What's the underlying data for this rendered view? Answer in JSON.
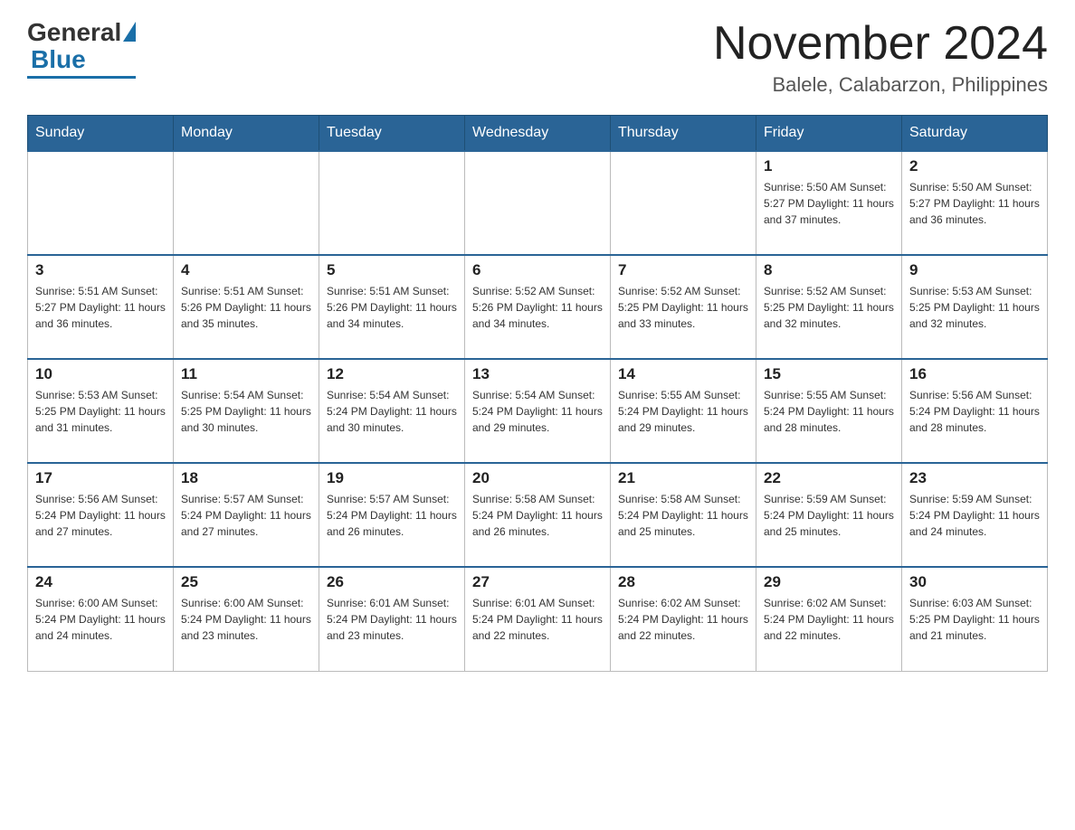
{
  "header": {
    "logo_general": "General",
    "logo_blue": "Blue",
    "month_title": "November 2024",
    "location": "Balele, Calabarzon, Philippines"
  },
  "weekdays": [
    "Sunday",
    "Monday",
    "Tuesday",
    "Wednesday",
    "Thursday",
    "Friday",
    "Saturday"
  ],
  "weeks": [
    [
      {
        "day": "",
        "info": ""
      },
      {
        "day": "",
        "info": ""
      },
      {
        "day": "",
        "info": ""
      },
      {
        "day": "",
        "info": ""
      },
      {
        "day": "",
        "info": ""
      },
      {
        "day": "1",
        "info": "Sunrise: 5:50 AM\nSunset: 5:27 PM\nDaylight: 11 hours and 37 minutes."
      },
      {
        "day": "2",
        "info": "Sunrise: 5:50 AM\nSunset: 5:27 PM\nDaylight: 11 hours and 36 minutes."
      }
    ],
    [
      {
        "day": "3",
        "info": "Sunrise: 5:51 AM\nSunset: 5:27 PM\nDaylight: 11 hours and 36 minutes."
      },
      {
        "day": "4",
        "info": "Sunrise: 5:51 AM\nSunset: 5:26 PM\nDaylight: 11 hours and 35 minutes."
      },
      {
        "day": "5",
        "info": "Sunrise: 5:51 AM\nSunset: 5:26 PM\nDaylight: 11 hours and 34 minutes."
      },
      {
        "day": "6",
        "info": "Sunrise: 5:52 AM\nSunset: 5:26 PM\nDaylight: 11 hours and 34 minutes."
      },
      {
        "day": "7",
        "info": "Sunrise: 5:52 AM\nSunset: 5:25 PM\nDaylight: 11 hours and 33 minutes."
      },
      {
        "day": "8",
        "info": "Sunrise: 5:52 AM\nSunset: 5:25 PM\nDaylight: 11 hours and 32 minutes."
      },
      {
        "day": "9",
        "info": "Sunrise: 5:53 AM\nSunset: 5:25 PM\nDaylight: 11 hours and 32 minutes."
      }
    ],
    [
      {
        "day": "10",
        "info": "Sunrise: 5:53 AM\nSunset: 5:25 PM\nDaylight: 11 hours and 31 minutes."
      },
      {
        "day": "11",
        "info": "Sunrise: 5:54 AM\nSunset: 5:25 PM\nDaylight: 11 hours and 30 minutes."
      },
      {
        "day": "12",
        "info": "Sunrise: 5:54 AM\nSunset: 5:24 PM\nDaylight: 11 hours and 30 minutes."
      },
      {
        "day": "13",
        "info": "Sunrise: 5:54 AM\nSunset: 5:24 PM\nDaylight: 11 hours and 29 minutes."
      },
      {
        "day": "14",
        "info": "Sunrise: 5:55 AM\nSunset: 5:24 PM\nDaylight: 11 hours and 29 minutes."
      },
      {
        "day": "15",
        "info": "Sunrise: 5:55 AM\nSunset: 5:24 PM\nDaylight: 11 hours and 28 minutes."
      },
      {
        "day": "16",
        "info": "Sunrise: 5:56 AM\nSunset: 5:24 PM\nDaylight: 11 hours and 28 minutes."
      }
    ],
    [
      {
        "day": "17",
        "info": "Sunrise: 5:56 AM\nSunset: 5:24 PM\nDaylight: 11 hours and 27 minutes."
      },
      {
        "day": "18",
        "info": "Sunrise: 5:57 AM\nSunset: 5:24 PM\nDaylight: 11 hours and 27 minutes."
      },
      {
        "day": "19",
        "info": "Sunrise: 5:57 AM\nSunset: 5:24 PM\nDaylight: 11 hours and 26 minutes."
      },
      {
        "day": "20",
        "info": "Sunrise: 5:58 AM\nSunset: 5:24 PM\nDaylight: 11 hours and 26 minutes."
      },
      {
        "day": "21",
        "info": "Sunrise: 5:58 AM\nSunset: 5:24 PM\nDaylight: 11 hours and 25 minutes."
      },
      {
        "day": "22",
        "info": "Sunrise: 5:59 AM\nSunset: 5:24 PM\nDaylight: 11 hours and 25 minutes."
      },
      {
        "day": "23",
        "info": "Sunrise: 5:59 AM\nSunset: 5:24 PM\nDaylight: 11 hours and 24 minutes."
      }
    ],
    [
      {
        "day": "24",
        "info": "Sunrise: 6:00 AM\nSunset: 5:24 PM\nDaylight: 11 hours and 24 minutes."
      },
      {
        "day": "25",
        "info": "Sunrise: 6:00 AM\nSunset: 5:24 PM\nDaylight: 11 hours and 23 minutes."
      },
      {
        "day": "26",
        "info": "Sunrise: 6:01 AM\nSunset: 5:24 PM\nDaylight: 11 hours and 23 minutes."
      },
      {
        "day": "27",
        "info": "Sunrise: 6:01 AM\nSunset: 5:24 PM\nDaylight: 11 hours and 22 minutes."
      },
      {
        "day": "28",
        "info": "Sunrise: 6:02 AM\nSunset: 5:24 PM\nDaylight: 11 hours and 22 minutes."
      },
      {
        "day": "29",
        "info": "Sunrise: 6:02 AM\nSunset: 5:24 PM\nDaylight: 11 hours and 22 minutes."
      },
      {
        "day": "30",
        "info": "Sunrise: 6:03 AM\nSunset: 5:25 PM\nDaylight: 11 hours and 21 minutes."
      }
    ]
  ]
}
